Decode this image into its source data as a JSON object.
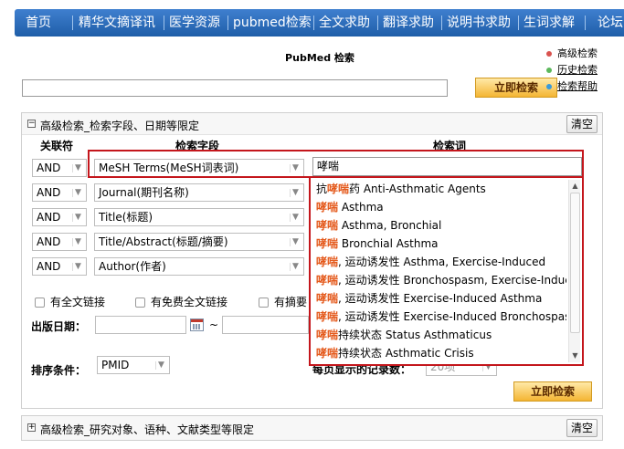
{
  "nav": {
    "items": [
      "首页",
      "精华文摘译讯",
      "医学资源",
      "pubmed检索",
      "全文求助",
      "翻译求助",
      "说明书求助",
      "生词求解",
      "论坛"
    ]
  },
  "search": {
    "title": "PubMed 检索",
    "main_value": "",
    "go_label": "立即检索"
  },
  "side_links": [
    {
      "label": "高级检索",
      "color": "#d9534f",
      "underline": false
    },
    {
      "label": "历史检索",
      "color": "#5cb85c",
      "underline": true
    },
    {
      "label": "检索帮助",
      "color": "#3a9ad9",
      "underline": true
    }
  ],
  "advanced": {
    "title": "高级检索_检索字段、日期等限定",
    "clear_label": "清空",
    "col_relation": "关联符",
    "col_field": "检索字段",
    "col_term": "检索词",
    "rows": [
      {
        "op": "AND",
        "field": "MeSH Terms(MeSH词表词)"
      },
      {
        "op": "AND",
        "field": "Journal(期刊名称)"
      },
      {
        "op": "AND",
        "field": "Title(标题)"
      },
      {
        "op": "AND",
        "field": "Title/Abstract(标题/摘要)"
      },
      {
        "op": "AND",
        "field": "Author(作者)"
      }
    ],
    "term_value": "哮喘",
    "checks": [
      "有全文链接",
      "有免费全文链接",
      "有摘要"
    ],
    "pub_date_label": "出版日期：",
    "date_sep": "~",
    "sort_label": "排序条件：",
    "sort_value": "PMID",
    "per_page_label": "每页显示的记录数：",
    "per_page_value": "20项",
    "go_label": "立即检索"
  },
  "suggestions": [
    {
      "pre": "抗",
      "k": "哮喘",
      "post": "药  Anti-Asthmatic Agents"
    },
    {
      "pre": "",
      "k": "哮喘",
      "post": "  Asthma"
    },
    {
      "pre": "",
      "k": "哮喘",
      "post": "  Asthma, Bronchial"
    },
    {
      "pre": "",
      "k": "哮喘",
      "post": "  Bronchial Asthma"
    },
    {
      "pre": "",
      "k": "哮喘",
      "post": ", 运动诱发性  Asthma, Exercise-Induced"
    },
    {
      "pre": "",
      "k": "哮喘",
      "post": ", 运动诱发性  Bronchospasm, Exercise-Induced"
    },
    {
      "pre": "",
      "k": "哮喘",
      "post": ", 运动诱发性  Exercise-Induced Asthma"
    },
    {
      "pre": "",
      "k": "哮喘",
      "post": ", 运动诱发性  Exercise-Induced Bronchospasm"
    },
    {
      "pre": "",
      "k": "哮喘",
      "post": "持续状态  Status Asthmaticus"
    },
    {
      "pre": "",
      "k": "哮喘",
      "post": "持续状态  Asthmatic Crisis"
    }
  ],
  "advanced2": {
    "title": "高级检索_研究对象、语种、文献类型等限定",
    "clear_label": "清空"
  }
}
